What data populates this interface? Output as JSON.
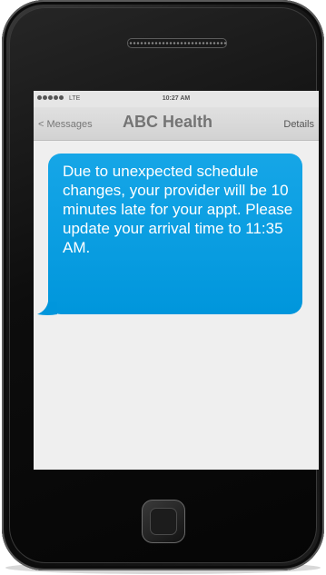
{
  "status_bar": {
    "signal_icon": "signal-dots-icon",
    "network": "LTE",
    "time": "10:27 AM"
  },
  "nav": {
    "back_label": "< Messages",
    "title": "ABC Health",
    "details_label": "Details"
  },
  "message": {
    "text": "Due to unexpected schedule changes, your provider will be 10 minutes late for your appt. Please update your arrival time to 11:35 AM.",
    "bubble_color": "#0096dc"
  },
  "device": {
    "speaker_icon": "speaker-grille-icon",
    "home_icon": "home-button-icon"
  }
}
